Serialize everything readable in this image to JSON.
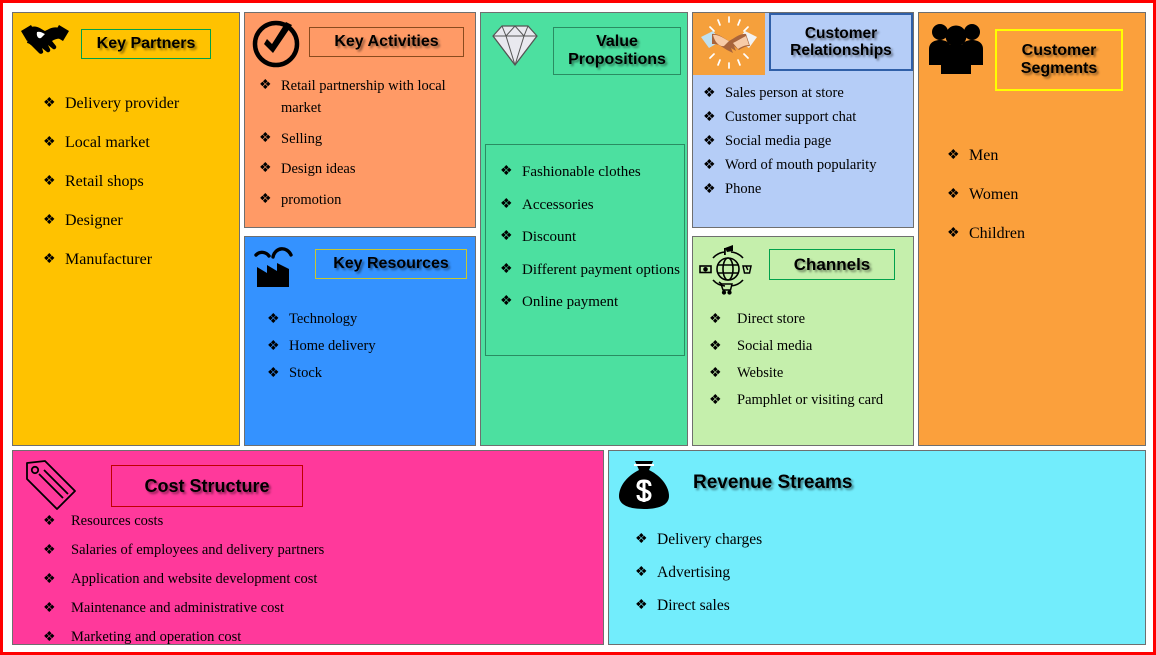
{
  "document": {
    "type": "Business Model Canvas",
    "outer_border_color": "#ff0000"
  },
  "blocks": {
    "key_partners": {
      "title": "Key Partners",
      "icon": "handshake-icon",
      "background_color": "#ffc200",
      "title_border_color": "#00a14b",
      "items": [
        "Delivery provider",
        "Local market",
        "Retail shops",
        "Designer",
        "Manufacturer"
      ]
    },
    "key_activities": {
      "title": "Key Activities",
      "icon": "check-circle-icon",
      "background_color": "#ff9a66",
      "title_border_color": "#8a4b1e",
      "items": [
        "Retail partnership with local market",
        "Selling",
        "Design ideas",
        "promotion"
      ]
    },
    "key_resources": {
      "title": "Key Resources",
      "icon": "factory-icon",
      "background_color": "#3492ff",
      "title_border_color": "#c8c832",
      "items": [
        "Technology",
        "Home delivery",
        "Stock"
      ]
    },
    "value_propositions": {
      "title": "Value Propositions",
      "icon": "diamond-gem-icon",
      "background_color": "#4ce0a0",
      "title_border_color": "#2a8c62",
      "items": [
        "Fashionable clothes",
        "Accessories",
        "Discount",
        "Different payment options",
        "Online payment"
      ]
    },
    "customer_relationships": {
      "title": "Customer Relationships",
      "icon": "handshake-color-icon",
      "background_color": "#b5cdf7",
      "title_border_color": "#2f5fa8",
      "items": [
        "Sales person at store",
        "Customer support chat",
        "Social media page",
        "Word of mouth popularity",
        "Phone"
      ]
    },
    "channels": {
      "title": "Channels",
      "icon": "globe-commerce-icon",
      "background_color": "#c5efac",
      "title_border_color": "#00a14b",
      "items": [
        "Direct store",
        "Social media",
        "Website",
        "Pamphlet or visiting card"
      ]
    },
    "customer_segments": {
      "title": "Customer Segments",
      "icon": "people-group-icon",
      "background_color": "#fba03c",
      "title_border_color": "#ffff00",
      "items": [
        "Men",
        "Women",
        "Children"
      ]
    },
    "cost_structure": {
      "title": "Cost Structure",
      "icon": "price-tag-icon",
      "background_color": "#ff399b",
      "title_border_color": "#c00000",
      "items": [
        "Resources costs",
        "Salaries of employees and delivery partners",
        "Application and website development cost",
        "Maintenance and administrative cost",
        "Marketing and operation cost"
      ]
    },
    "revenue_streams": {
      "title": "Revenue Streams",
      "icon": "money-bag-icon",
      "background_color": "#72edfc",
      "title_border_color": "none",
      "items": [
        "Delivery charges",
        "Advertising",
        "Direct sales"
      ]
    }
  }
}
